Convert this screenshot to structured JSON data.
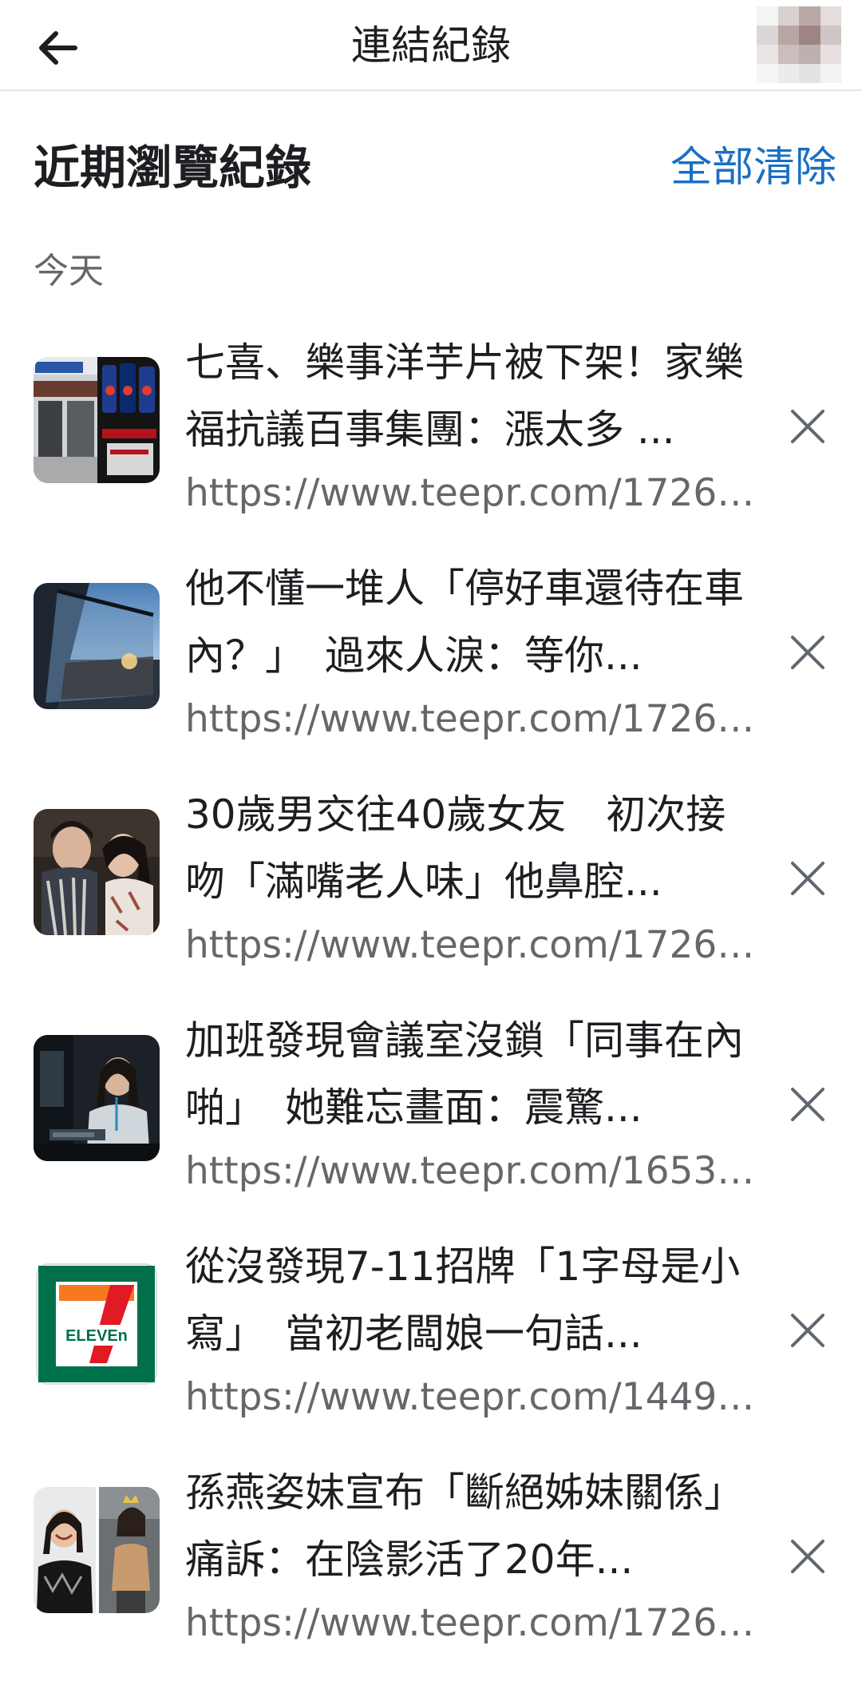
{
  "header": {
    "back_icon": "arrow-left-icon",
    "title": "連結紀錄"
  },
  "section": {
    "title": "近期瀏覽紀錄",
    "clear_all_label": "全部清除",
    "accent_color": "#1a6fc4"
  },
  "day_label": "今天",
  "items": [
    {
      "title": "七喜、樂事洋芋片被下架！家樂福抗議百事集團：漲太多 ...",
      "url": "https://www.teepr.com/17265...",
      "thumb": "store-shelf-thumbnail"
    },
    {
      "title": "他不懂一堆人「停好車還待在車內？」　過來人淚：等你...",
      "url": "https://www.teepr.com/17265...",
      "thumb": "car-mirror-thumbnail"
    },
    {
      "title": "30歲男交往40歲女友　初次接吻「滿嘴老人味」他鼻腔...",
      "url": "https://www.teepr.com/17264...",
      "thumb": "couple-thumbnail"
    },
    {
      "title": "加班發現會議室沒鎖「同事在內啪」　她難忘畫面：震驚...",
      "url": "https://www.teepr.com/16536...",
      "thumb": "office-woman-thumbnail"
    },
    {
      "title": "從沒發現7-11招牌「1字母是小寫」　當初老闆娘一句話...",
      "url": "https://www.teepr.com/14490...",
      "thumb": "seven-eleven-logo-thumbnail",
      "logo_text": "ELEVEn"
    },
    {
      "title": "孫燕姿妹宣布「斷絕姊妹關係」痛訴：在陰影活了20年...",
      "url": "https://www.teepr.com/17266...",
      "thumb": "two-women-thumbnail"
    }
  ]
}
